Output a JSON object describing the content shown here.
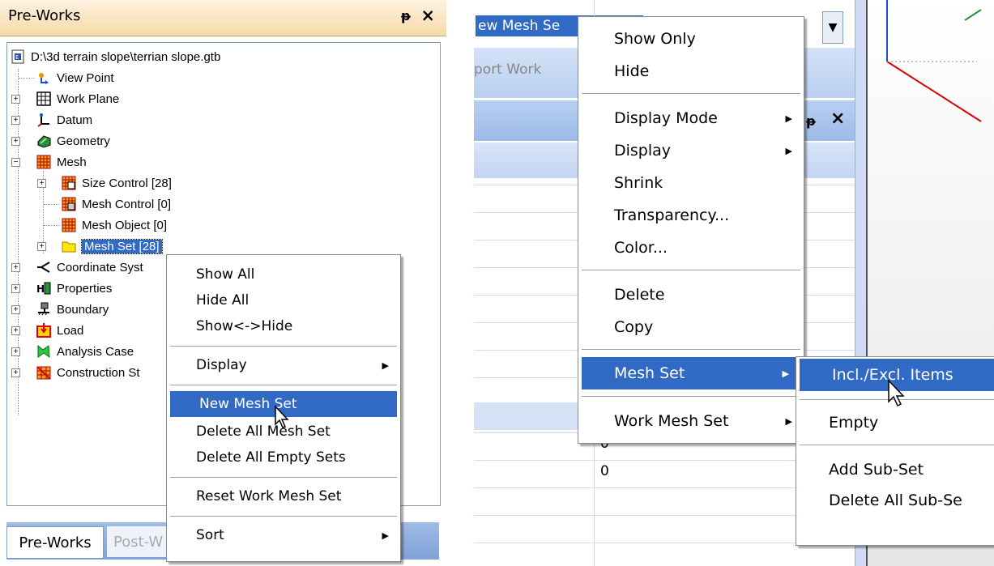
{
  "left": {
    "title": "Pre-Works",
    "pin": "ᵽ",
    "close": "×",
    "tree": [
      {
        "label": "D:\\3d terrain slope\\terrian slope.gtb",
        "icon": "file-icon"
      },
      {
        "label": "View Point",
        "icon": "view-point-icon"
      },
      {
        "label": "Work Plane",
        "icon": "grid-icon"
      },
      {
        "label": "Datum",
        "icon": "axis-icon"
      },
      {
        "label": "Geometry",
        "icon": "geometry-icon"
      },
      {
        "label": "Mesh",
        "icon": "mesh-icon"
      },
      {
        "label": "Size Control [28]",
        "icon": "size-control-icon"
      },
      {
        "label": "Mesh Control [0]",
        "icon": "mesh-control-icon"
      },
      {
        "label": "Mesh Object [0]",
        "icon": "mesh-object-icon"
      },
      {
        "label": "Mesh Set [28]",
        "icon": "folder-icon"
      },
      {
        "label": "Coordinate Syst",
        "icon": "coordinate-icon"
      },
      {
        "label": "Properties",
        "icon": "properties-icon"
      },
      {
        "label": "Boundary",
        "icon": "boundary-icon"
      },
      {
        "label": "Load",
        "icon": "load-icon"
      },
      {
        "label": "Analysis Case",
        "icon": "analysis-case-icon"
      },
      {
        "label": "Construction St",
        "icon": "construction-stage-icon"
      }
    ],
    "tabs": [
      "Pre-Works",
      "Post-W"
    ],
    "menu": {
      "show_all": "Show All",
      "hide_all": "Hide All",
      "show_hide": "Show<->Hide",
      "display": "Display",
      "new_mesh_set": "New Mesh Set",
      "delete_all_mesh_set": "Delete All Mesh Set",
      "delete_all_empty_sets": "Delete All Empty Sets",
      "reset_work_mesh_set": "Reset Work Mesh Set",
      "sort": "Sort"
    }
  },
  "right": {
    "top_cell": "ew Mesh Se",
    "tab_fragment": "port Work",
    "pin": "ᵽ",
    "close": "×",
    "values": [
      "0",
      "0"
    ],
    "menu": {
      "show_only": "Show Only",
      "hide": "Hide",
      "display_mode": "Display Mode",
      "display": "Display",
      "shrink": "Shrink",
      "transparency": "Transparency...",
      "color": "Color...",
      "delete": "Delete",
      "copy": "Copy",
      "mesh_set": "Mesh Set",
      "work_mesh_set": "Work Mesh Set"
    },
    "submenu": {
      "incl_excl": "Incl./Excl. Items",
      "empty": "Empty",
      "add_sub_set": "Add Sub-Set",
      "delete_all_sub_sets": "Delete All Sub-Se"
    }
  },
  "colors": {
    "highlight": "#316ac5",
    "title_gradient_bottom": "#f7d9a9",
    "tab_blue": "#7fa2d8"
  }
}
